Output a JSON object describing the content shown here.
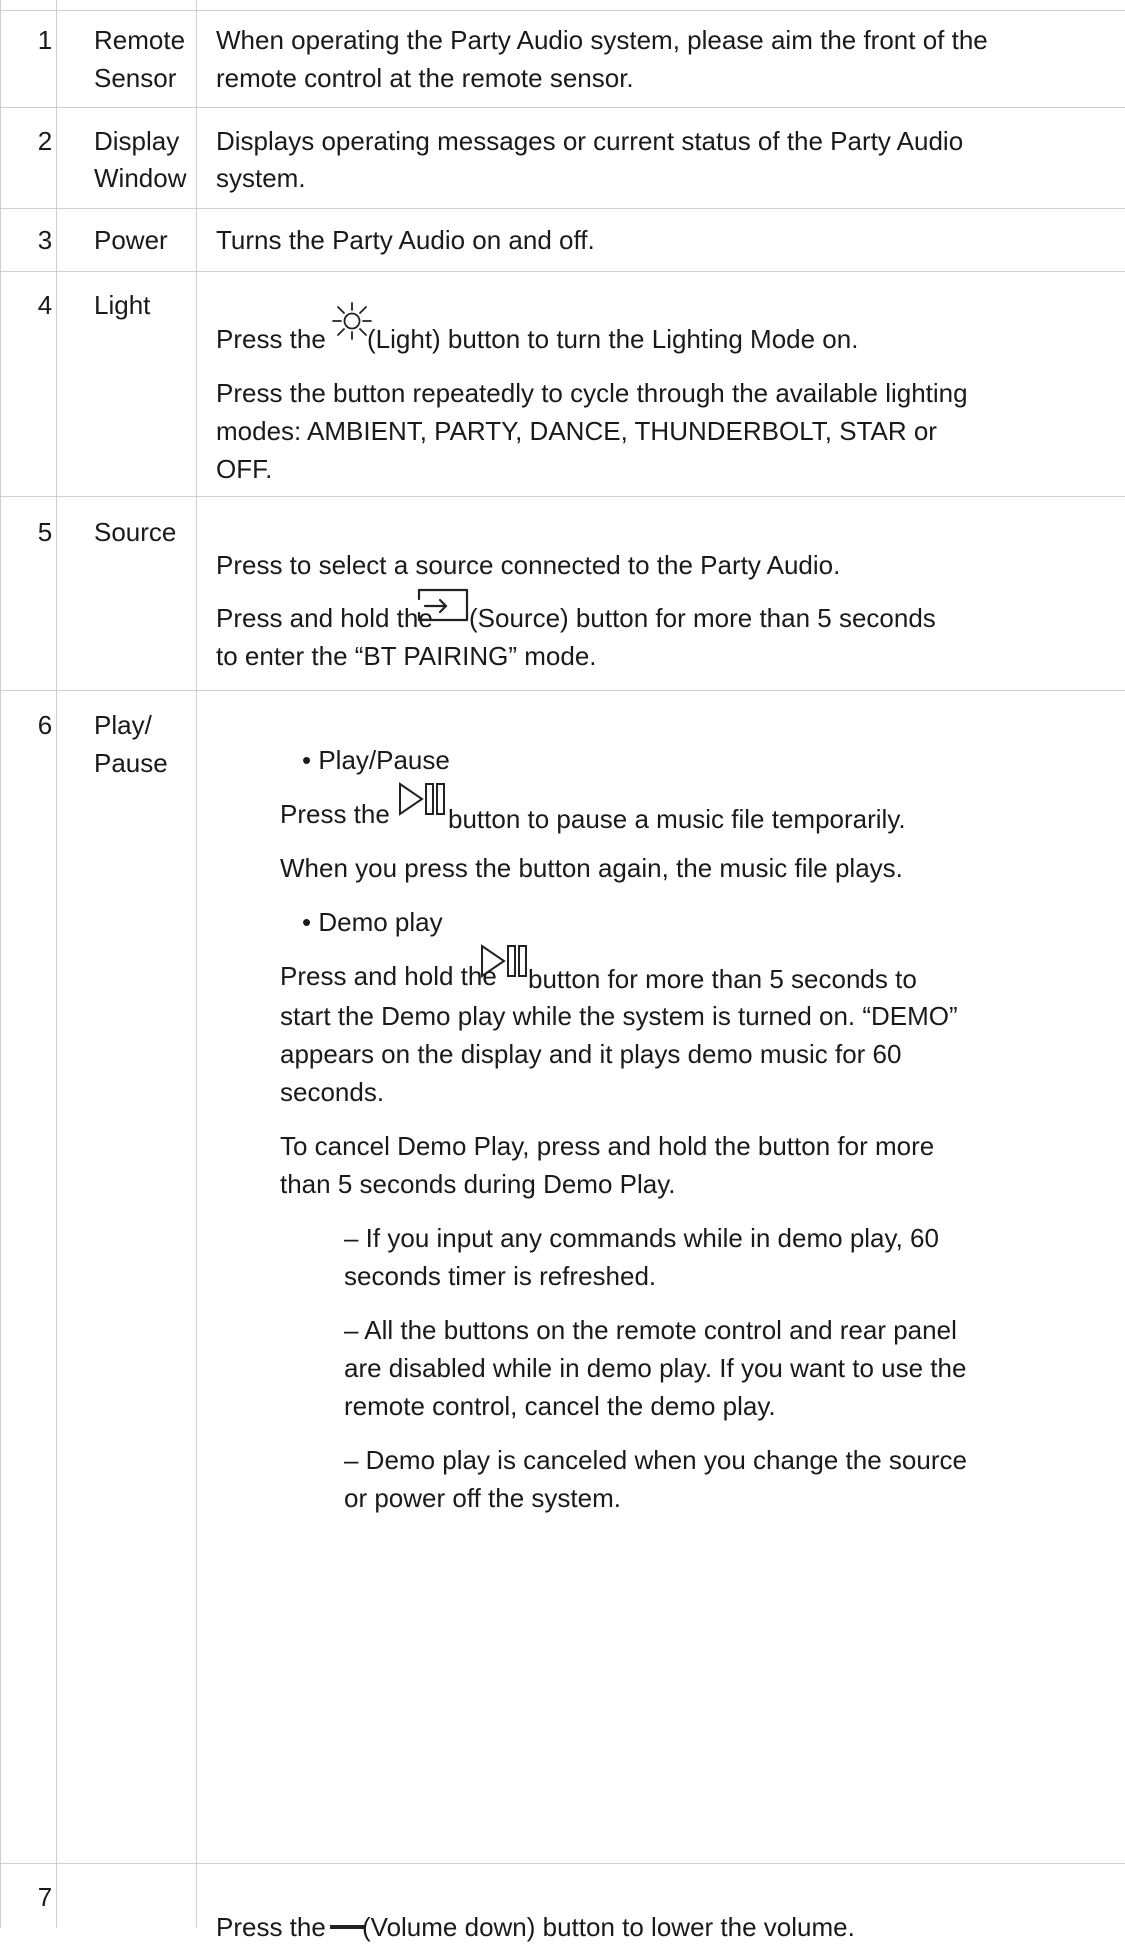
{
  "rows": [
    {
      "number": "1",
      "name_lines": [
        "Remote",
        "Sensor"
      ],
      "desc_lines": [
        "When operating the Party Audio system, please aim the front of the",
        "remote control at the remote sensor."
      ]
    },
    {
      "number": "2",
      "name_lines": [
        "Display",
        "Window"
      ],
      "desc_lines": [
        "Displays operating messages or current status of the Party Audio",
        "system."
      ]
    },
    {
      "number": "3",
      "name_lines": [
        "Power"
      ],
      "desc_lines": [
        "Turns the Party Audio on and off."
      ]
    },
    {
      "number": "4",
      "name_lines": [
        "Light"
      ],
      "desc": {
        "press_the": "Press the",
        "after_icon": "(Light) button to turn the Lighting Mode on.",
        "p2_lines": [
          "Press the button repeatedly to cycle through the available lighting",
          "modes: AMBIENT, PARTY, DANCE, THUNDERBOLT, STAR or",
          "OFF."
        ]
      }
    },
    {
      "number": "5",
      "name_lines": [
        "Source"
      ],
      "desc": {
        "p1": "Press to select a source connected to the Party Audio.",
        "press_hold": "Press and hold the",
        "after_icon": "(Source) button for more than 5 seconds",
        "line2": "to enter the “BT PAIRING” mode."
      }
    },
    {
      "number": "6",
      "name_lines": [
        "Play/",
        "Pause"
      ],
      "desc": {
        "bullet1": "• Play/Pause",
        "press_the": "Press the",
        "after_icon1": "button to pause a music file temporarily.",
        "again": "When you press the button again, the music file plays.",
        "bullet2": "• Demo play",
        "press_hold": "Press and hold the",
        "after_icon2": "button for more than 5 seconds to",
        "demo_lines": [
          "start the Demo play while the system is turned on. “DEMO”",
          "appears on the display and it plays demo music for 60",
          "seconds."
        ],
        "cancel_lines": [
          "To cancel Demo Play, press and hold the button for more",
          "than 5 seconds during Demo Play."
        ],
        "note1_lines": [
          "– If you input any commands while in demo play, 60",
          "seconds timer is refreshed."
        ],
        "note2_lines": [
          "– All the buttons on the remote control and rear panel",
          "are disabled while in demo play. If you want to use the",
          "remote control, cancel the demo play."
        ],
        "note3_lines": [
          "– Demo play is canceled when you change the source",
          "or power off the system."
        ]
      }
    },
    {
      "number": "7",
      "name_lines": [],
      "desc": {
        "press_the": "Press the",
        "after_icon": "(Volume down) button to lower the volume."
      }
    }
  ],
  "icons": [
    "sun-icon",
    "source-input-icon",
    "play-pause-icon",
    "minus-icon"
  ]
}
